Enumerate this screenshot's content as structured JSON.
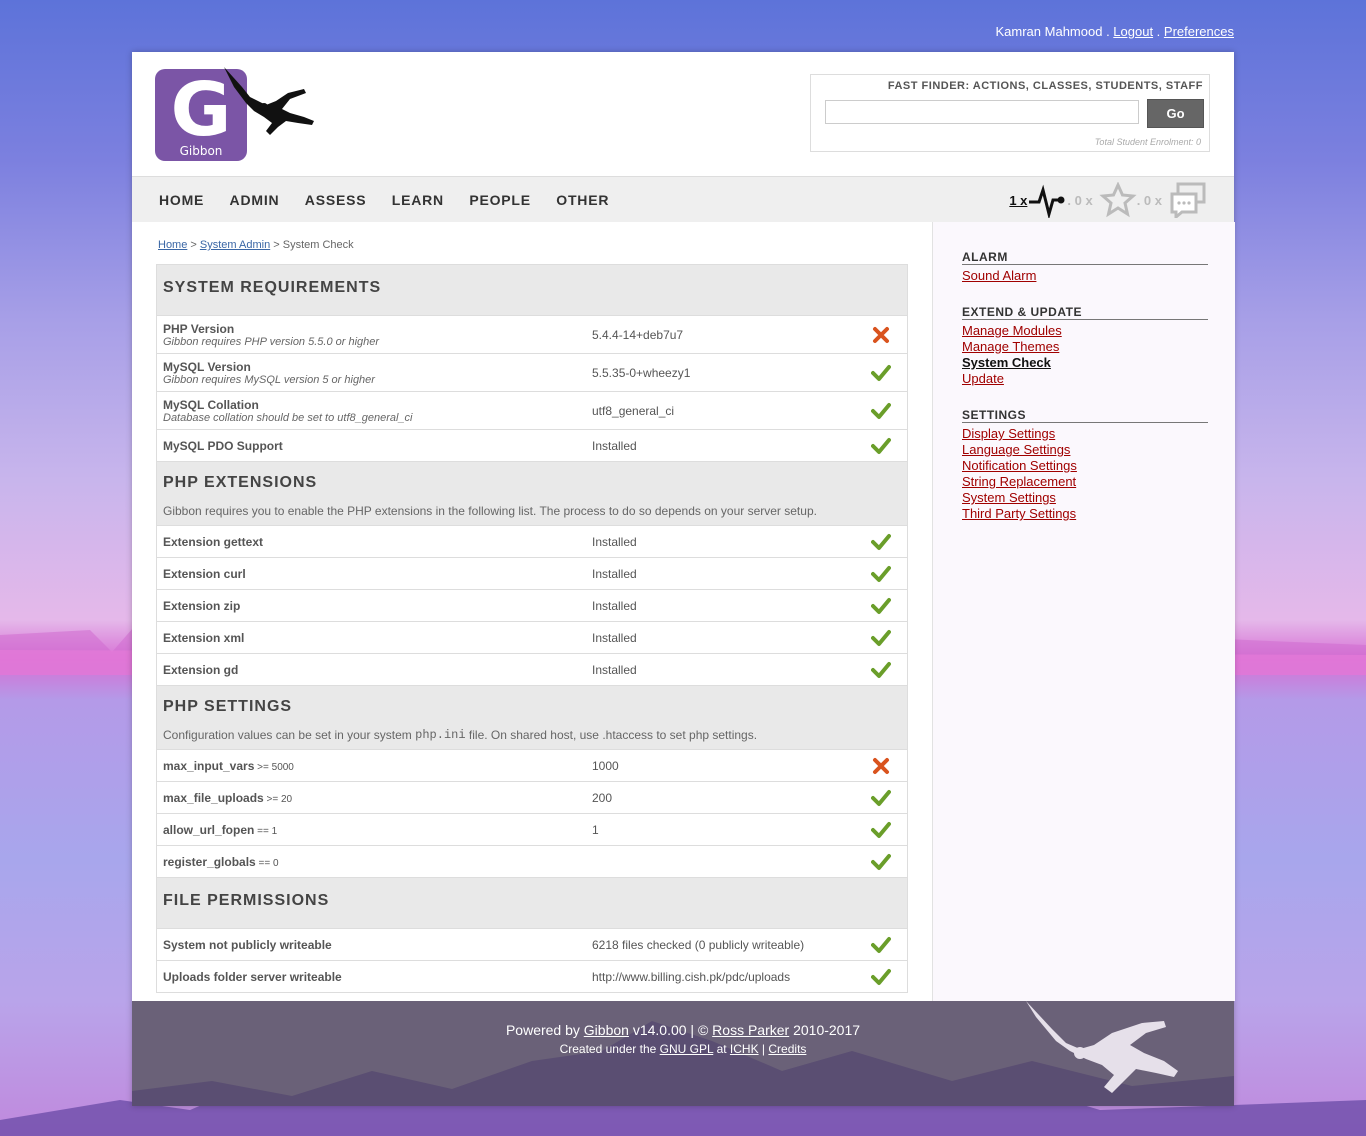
{
  "user": {
    "name": "Kamran Mahmood",
    "sep": " . ",
    "logout": "Logout",
    "preferences": "Preferences"
  },
  "logo": {
    "text": "Gibbon"
  },
  "finder": {
    "title": "FAST FINDER: ACTIONS, CLASSES, STUDENTS, STAFF",
    "value": "",
    "go": "Go",
    "enrolment": "Total Student Enrolment: 0"
  },
  "nav": {
    "items": [
      "HOME",
      "ADMIN",
      "ASSESS",
      "LEARN",
      "PEOPLE",
      "OTHER"
    ]
  },
  "notifications": {
    "alarm_count": "1 x",
    "likes_count": ". 0 x",
    "messages_count": ". 0 x"
  },
  "breadcrumb": {
    "home": "Home",
    "sep": " > ",
    "admin": "System Admin",
    "current": "System Check"
  },
  "sections": {
    "requirements": {
      "title": "SYSTEM REQUIREMENTS"
    },
    "extensions": {
      "title": "PHP EXTENSIONS",
      "desc": "Gibbon requires you to enable the PHP extensions in the following list. The process to do so depends on your server setup."
    },
    "settings": {
      "title": "PHP SETTINGS",
      "desc_pre": "Configuration values can be set in your system ",
      "desc_code": "php.ini",
      "desc_post": " file. On shared host, use .htaccess to set php settings."
    },
    "permissions": {
      "title": "FILE PERMISSIONS"
    }
  },
  "rows": {
    "php_version": {
      "label": "PHP Version",
      "sub": "Gibbon requires PHP version 5.5.0 or higher",
      "value": "5.4.4-14+deb7u7",
      "status": "fail"
    },
    "mysql_version": {
      "label": "MySQL Version",
      "sub": "Gibbon requires MySQL version 5 or higher",
      "value": "5.5.35-0+wheezy1",
      "status": "ok"
    },
    "mysql_collation": {
      "label": "MySQL Collation",
      "sub": "Database collation should be set to utf8_general_ci",
      "value": "utf8_general_ci",
      "status": "ok"
    },
    "mysql_pdo": {
      "label": "MySQL PDO Support",
      "value": "Installed",
      "status": "ok"
    },
    "ext_gettext": {
      "label": "Extension gettext",
      "value": "Installed",
      "status": "ok"
    },
    "ext_curl": {
      "label": "Extension curl",
      "value": "Installed",
      "status": "ok"
    },
    "ext_zip": {
      "label": "Extension zip",
      "value": "Installed",
      "status": "ok"
    },
    "ext_xml": {
      "label": "Extension xml",
      "value": "Installed",
      "status": "ok"
    },
    "ext_gd": {
      "label": "Extension gd",
      "value": "Installed",
      "status": "ok"
    },
    "max_input_vars": {
      "label": "max_input_vars",
      "req": " >= 5000",
      "value": "1000",
      "status": "fail"
    },
    "max_file_uploads": {
      "label": "max_file_uploads",
      "req": " >= 20",
      "value": "200",
      "status": "ok"
    },
    "allow_url_fopen": {
      "label": "allow_url_fopen",
      "req": " == 1",
      "value": "1",
      "status": "ok"
    },
    "register_globals": {
      "label": "register_globals",
      "req": " == 0",
      "value": "",
      "status": "ok"
    },
    "not_public": {
      "label": "System not publicly writeable",
      "value": "6218 files checked (0 publicly writeable)",
      "status": "ok"
    },
    "uploads": {
      "label": "Uploads folder server writeable",
      "value": "http://www.billing.cish.pk/pdc/uploads",
      "status": "ok"
    }
  },
  "sidebar": {
    "alarm": {
      "heading": "ALARM",
      "links": [
        "Sound Alarm"
      ]
    },
    "extend": {
      "heading": "EXTEND & UPDATE",
      "links": [
        "Manage Modules",
        "Manage Themes",
        "System Check",
        "Update"
      ]
    },
    "settings": {
      "heading": "SETTINGS",
      "links": [
        "Display Settings",
        "Language Settings",
        "Notification Settings",
        "String Replacement",
        "System Settings",
        "Third Party Settings"
      ]
    }
  },
  "footer": {
    "powered": "Powered by ",
    "gibbon": "Gibbon",
    "version": " v14.0.00 | © ",
    "author": "Ross Parker",
    "years": " 2010-2017",
    "created": "Created under the ",
    "license": "GNU GPL",
    "at": " at ",
    "org": "ICHK",
    "pipe": " | ",
    "credits": "Credits"
  },
  "colors": {
    "ok": "#6a9e2a",
    "fail": "#d9531e",
    "link": "#a00000",
    "accent": "#7b55a6"
  }
}
